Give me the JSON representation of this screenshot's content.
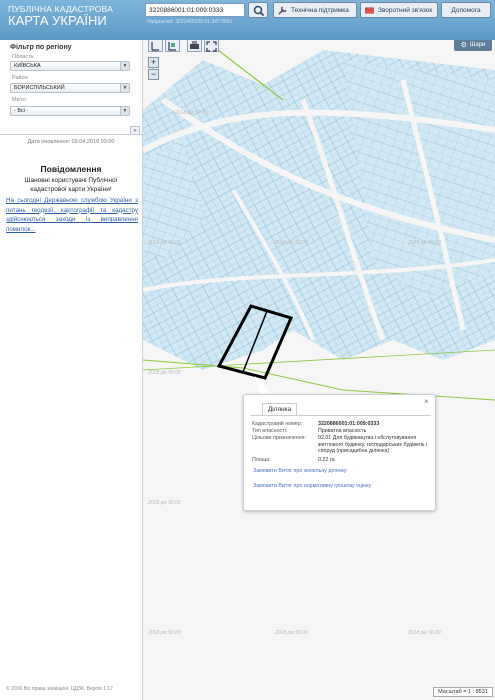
{
  "header": {
    "brand_top": "ПУБЛІЧНА КАДАСТРОВА",
    "brand_main": "КАРТА УКРАЇНИ",
    "search_value": "3220886001:01:009:0333",
    "search_hint": "Наприклад: 3221455100:01:347:0061",
    "buttons": {
      "support": "Технічна підтримка",
      "feedback": "Зворотний зв'язок",
      "help": "Допомога"
    }
  },
  "sidebar": {
    "filter_title": "Фільтр по регіону",
    "fields": [
      {
        "label": "Область",
        "value": "КИЇВСЬКА"
      },
      {
        "label": "Район",
        "value": "БОРИСПІЛЬСЬКИЙ"
      },
      {
        "label": "Місто",
        "value": "- Всі -"
      }
    ],
    "update_date": "Дата оновлення: 03.04.2018 03:00",
    "notice_title": "Повідомлення",
    "notice_greeting": "Шановні користувачі Публічної кадастрової карти України!",
    "notice_link": "На сьогодні Державною службою України з питань геодезії, картографії та кадастру здійснюються заходи із виправлення помилок...",
    "footer": "© 2016 Всі права захищені. ЦДЗК. Версія 1.17"
  },
  "map": {
    "layers_label": "Шари",
    "zoom_in": "+",
    "zoom_out": "−",
    "scale": "Масштаб = 1 : 8531",
    "watermark": "2018 рік 50.00"
  },
  "popup": {
    "tab": "Ділянка",
    "rows": [
      {
        "key": "Кадастровий номер:",
        "value": "3220886001:01:009:0333"
      },
      {
        "key": "Тип власності:",
        "value": "Приватна власність"
      },
      {
        "key": "Цільове призначення:",
        "value": "02.01 Для будівництва і обслуговування житлового будинку, господарських будівель і споруд (присадибна ділянка)"
      },
      {
        "key": "Площа:",
        "value": "0.22 га"
      }
    ],
    "link1": "Замовити Витяг про земельну ділянку",
    "link2": "Замовити Витяг про нормативну грошову оцінку"
  },
  "colors": {
    "header": "#6aa5d2",
    "parcel_fill": "#cfe7f3",
    "parcel_stroke": "#7fb7d6",
    "selected": "#000000",
    "road_green": "#8cc83a",
    "link": "#4a74b8"
  }
}
